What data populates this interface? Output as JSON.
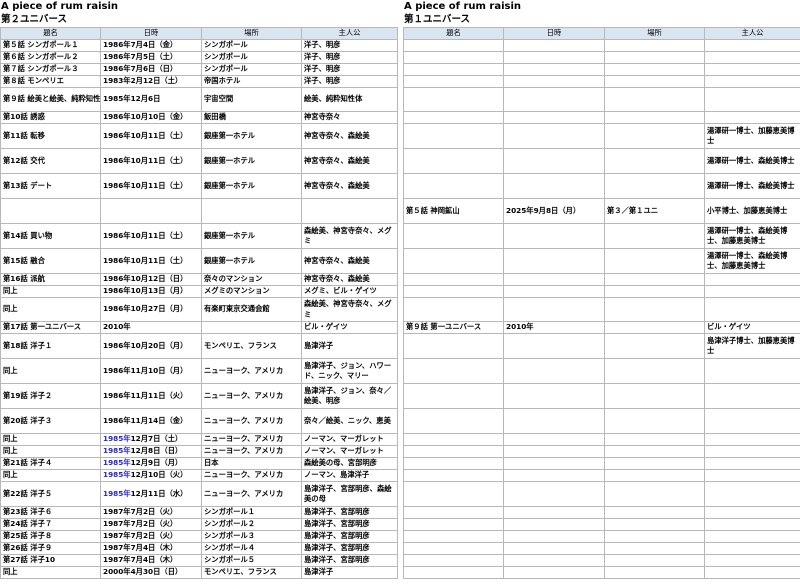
{
  "left": {
    "title": "A piece of rum raisin",
    "subtitle": "第２ユニバース",
    "headers": [
      "題名",
      "日時",
      "場所",
      "主人公"
    ],
    "rows": [
      {
        "ep": "第５話 シンガポール１",
        "date": "1986年7月4日（金）",
        "place": "シンガポール",
        "cast": "洋子、明彦",
        "h": 12
      },
      {
        "ep": "第６話 シンガポール２",
        "date": "1986年7月5日（土）",
        "place": "シンガポール",
        "cast": "洋子、明彦",
        "h": 12
      },
      {
        "ep": "第７話 シンガポール３",
        "date": "1986年7月6日（日）",
        "place": "シンガポール",
        "cast": "洋子、明彦",
        "h": 12
      },
      {
        "ep": "第８話 モンペリエ",
        "date": "1983年2月12日（土）",
        "place": "帝国ホテル",
        "cast": "洋子、明彦",
        "h": 12
      },
      {
        "ep": "第９話 絵美と絵美、純粋知性体、絵美と奈々",
        "date": "1985年12月6日",
        "place": "宇宙空間",
        "cast": "絵美、純粋知性体",
        "h": 24
      },
      {
        "ep": "第10話 誘惑",
        "date": "1986年10月10日（金）",
        "place": "飯田橋",
        "cast": "神宮寺奈々",
        "h": 12
      },
      {
        "ep": "第11話 転移",
        "date": "1986年10月11日（土）",
        "place": "銀座第一ホテル",
        "cast": "神宮寺奈々、森絵美",
        "h": 25
      },
      {
        "ep": "第12話 交代",
        "date": "1986年10月11日（土）",
        "place": "銀座第一ホテル",
        "cast": "神宮寺奈々、森絵美",
        "h": 25
      },
      {
        "ep": "第13話 デート",
        "date": "1986年10月11日（土）",
        "place": "銀座第一ホテル",
        "cast": "神宮寺奈々、森絵美",
        "h": 25
      },
      {
        "ep": "",
        "date": "",
        "place": "",
        "cast": "",
        "h": 25
      },
      {
        "ep": "第14話 買い物",
        "date": "1986年10月11日（土）",
        "place": "銀座第一ホテル",
        "cast": "森絵美、神宮寺奈々、メグミ",
        "h": 25
      },
      {
        "ep": "第15話 融合",
        "date": "1986年10月11日（土）",
        "place": "銀座第一ホテル",
        "cast": "神宮寺奈々、森絵美",
        "h": 25
      },
      {
        "ep": "第16話 派航",
        "date": "1986年10月12日（日）",
        "place": "奈々のマンション",
        "cast": "神宮寺奈々、森絵美",
        "h": 12
      },
      {
        "ep": "同上",
        "date": "1986年10月13日（月）",
        "place": "メグミのマンション",
        "cast": "メグミ、ビル・ゲイツ",
        "h": 12
      },
      {
        "ep": "同上",
        "date": "1986年10月27日（月）",
        "place": "有楽町東京交通会館",
        "cast": "森絵美、神宮寺奈々、メグミ",
        "h": 24
      },
      {
        "ep": "第17話 第一ユニバース",
        "date": "2010年",
        "place": "",
        "cast": "ビル・ゲイツ",
        "h": 12
      },
      {
        "ep": "第18話 洋子１",
        "date": "1986年10月20日（月）",
        "place": "モンペリエ、フランス",
        "cast": "島津洋子",
        "h": 25
      },
      {
        "ep": "同上",
        "date": "1986年11月10日（月）",
        "place": "ニューヨーク、アメリカ",
        "cast": "島津洋子、ジョン、ハワード、ニック、マリー",
        "h": 25
      },
      {
        "ep": "第19話 洋子２",
        "date": "1986年11月11日（火）",
        "place": "ニューヨーク、アメリカ",
        "cast": "島津洋子、ジョン、奈々／絵美、明彦",
        "h": 25
      },
      {
        "ep": "第20話 洋子３",
        "date": "1986年11月14日（金）",
        "place": "ニューヨーク、アメリカ",
        "cast": "奈々／絵美、ニック、恵美",
        "h": 25
      },
      {
        "ep": "同上",
        "date": "1985年12月7日（土）",
        "blue": "1985年",
        "place": "ニューヨーク、アメリカ",
        "cast": "ノーマン、マーガレット",
        "h": 12
      },
      {
        "ep": "同上",
        "date": "1985年12月8日（日）",
        "blue": "1985年",
        "place": "ニューヨーク、アメリカ",
        "cast": "ノーマン、マーガレット",
        "h": 12
      },
      {
        "ep": "第21話 洋子４",
        "date": "1985年12月9日（月）",
        "blue": "1985年",
        "place": "日本",
        "cast": "森絵美の母、宮部明彦",
        "h": 12
      },
      {
        "ep": "同上",
        "date": "1985年12月10日（火）",
        "blue": "1985年",
        "place": "ニューヨーク、アメリカ",
        "cast": "ノーマン、島津洋子",
        "h": 12
      },
      {
        "ep": "第22話 洋子５",
        "date": "1985年12月11日（水）",
        "blue": "1985年",
        "place": "ニューヨーク、アメリカ",
        "cast": "島津洋子、宮部明彦、森絵美の母",
        "h": 25
      },
      {
        "ep": "第23話 洋子６",
        "date": "1987年7月2日（火）",
        "place": "シンガポール１",
        "cast": "島津洋子、宮部明彦",
        "h": 12
      },
      {
        "ep": "第24話 洋子７",
        "date": "1987年7月2日（火）",
        "place": "シンガポール２",
        "cast": "島津洋子、宮部明彦",
        "h": 12
      },
      {
        "ep": "第25話 洋子８",
        "date": "1987年7月2日（火）",
        "place": "シンガポール３",
        "cast": "島津洋子、宮部明彦",
        "h": 12
      },
      {
        "ep": "第26話 洋子９",
        "date": "1987年7月4日（木）",
        "place": "シンガポール４",
        "cast": "島津洋子、宮部明彦",
        "h": 12
      },
      {
        "ep": "第27話 洋子10",
        "date": "1987年7月4日（木）",
        "place": "シンガポール５",
        "cast": "島津洋子、宮部明彦",
        "h": 12
      },
      {
        "ep": "同上",
        "date": "2000年4月30日（日）",
        "place": "モンペリエ、フランス",
        "cast": "島津洋子",
        "h": 12
      }
    ]
  },
  "right": {
    "title": "A piece of rum raisin",
    "subtitle": "第１ユニバース",
    "headers": [
      "題名",
      "日時",
      "場所",
      "主人公"
    ],
    "rows": [
      {
        "ep": "",
        "date": "",
        "place": "",
        "cast": "",
        "h": 12
      },
      {
        "ep": "",
        "date": "",
        "place": "",
        "cast": "",
        "h": 12
      },
      {
        "ep": "",
        "date": "",
        "place": "",
        "cast": "",
        "h": 12
      },
      {
        "ep": "",
        "date": "",
        "place": "",
        "cast": "",
        "h": 12
      },
      {
        "ep": "",
        "date": "",
        "place": "",
        "cast": "",
        "h": 24
      },
      {
        "ep": "",
        "date": "",
        "place": "",
        "cast": "",
        "h": 12
      },
      {
        "ep": "",
        "date": "",
        "place": "",
        "cast": "湯澤研一博士、加藤恵美博士",
        "h": 25
      },
      {
        "ep": "",
        "date": "",
        "place": "",
        "cast": "湯澤研一博士、森絵美博士",
        "h": 25
      },
      {
        "ep": "",
        "date": "",
        "place": "",
        "cast": "湯澤研一博士、森絵美博士",
        "h": 25
      },
      {
        "ep": "第５話 神岡鉱山",
        "date": "2025年9月8日（月）",
        "place": "第３／第１ユニ",
        "cast": "小平博士、加藤恵美博士",
        "h": 25
      },
      {
        "ep": "",
        "date": "",
        "place": "",
        "cast": "湯澤研一博士、森絵美博士、加藤恵美博士",
        "h": 25
      },
      {
        "ep": "",
        "date": "",
        "place": "",
        "cast": "湯澤研一博士、森絵美博士、加藤恵美博士",
        "h": 25
      },
      {
        "ep": "",
        "date": "",
        "place": "",
        "cast": "",
        "h": 12
      },
      {
        "ep": "",
        "date": "",
        "place": "",
        "cast": "",
        "h": 12
      },
      {
        "ep": "",
        "date": "",
        "place": "",
        "cast": "",
        "h": 24
      },
      {
        "ep": "第９話 第一ユニバース",
        "date": "2010年",
        "place": "",
        "cast": "ビル・ゲイツ",
        "h": 12
      },
      {
        "ep": "",
        "date": "",
        "place": "",
        "cast": "島津洋子博士、加藤恵美博士",
        "h": 25
      },
      {
        "ep": "",
        "date": "",
        "place": "",
        "cast": "",
        "h": 25
      },
      {
        "ep": "",
        "date": "",
        "place": "",
        "cast": "",
        "h": 25
      },
      {
        "ep": "",
        "date": "",
        "place": "",
        "cast": "",
        "h": 25
      },
      {
        "ep": "",
        "date": "",
        "place": "",
        "cast": "",
        "h": 12
      },
      {
        "ep": "",
        "date": "",
        "place": "",
        "cast": "",
        "h": 12
      },
      {
        "ep": "",
        "date": "",
        "place": "",
        "cast": "",
        "h": 12
      },
      {
        "ep": "",
        "date": "",
        "place": "",
        "cast": "",
        "h": 12
      },
      {
        "ep": "",
        "date": "",
        "place": "",
        "cast": "",
        "h": 25
      },
      {
        "ep": "",
        "date": "",
        "place": "",
        "cast": "",
        "h": 12
      },
      {
        "ep": "",
        "date": "",
        "place": "",
        "cast": "",
        "h": 12
      },
      {
        "ep": "",
        "date": "",
        "place": "",
        "cast": "",
        "h": 12
      },
      {
        "ep": "",
        "date": "",
        "place": "",
        "cast": "",
        "h": 12
      },
      {
        "ep": "",
        "date": "",
        "place": "",
        "cast": "",
        "h": 12
      },
      {
        "ep": "",
        "date": "",
        "place": "",
        "cast": "",
        "h": 12
      }
    ]
  }
}
